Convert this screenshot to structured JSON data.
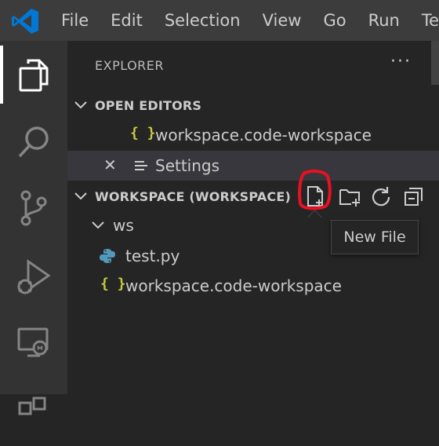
{
  "menu": [
    "File",
    "Edit",
    "Selection",
    "View",
    "Go",
    "Run",
    "Terr"
  ],
  "activity_bar": [
    "explorer-icon",
    "search-icon",
    "source-control-icon",
    "run-debug-icon",
    "remote-explorer-icon"
  ],
  "explorer": {
    "title": "EXPLORER",
    "more": "···",
    "open_editors": {
      "label": "OPEN EDITORS",
      "items": [
        {
          "name": "workspace.code-workspace",
          "icon": "{ }"
        },
        {
          "name": "Settings",
          "icon": "settings-lines-icon",
          "close": "✕"
        }
      ]
    },
    "workspace": {
      "label": "WORKSPACE (WORKSPACE)",
      "folder": "ws",
      "files": [
        {
          "name": "test.py",
          "icon": "python-icon"
        },
        {
          "name": "workspace.code-workspace",
          "icon": "{ }"
        }
      ]
    }
  },
  "tooltip": "New File",
  "colors": {
    "titlebar": "#3c3c3c",
    "activitybar": "#333333",
    "sidebar": "#252526",
    "braces": "#cbcb41",
    "annotation": "#e81123"
  }
}
